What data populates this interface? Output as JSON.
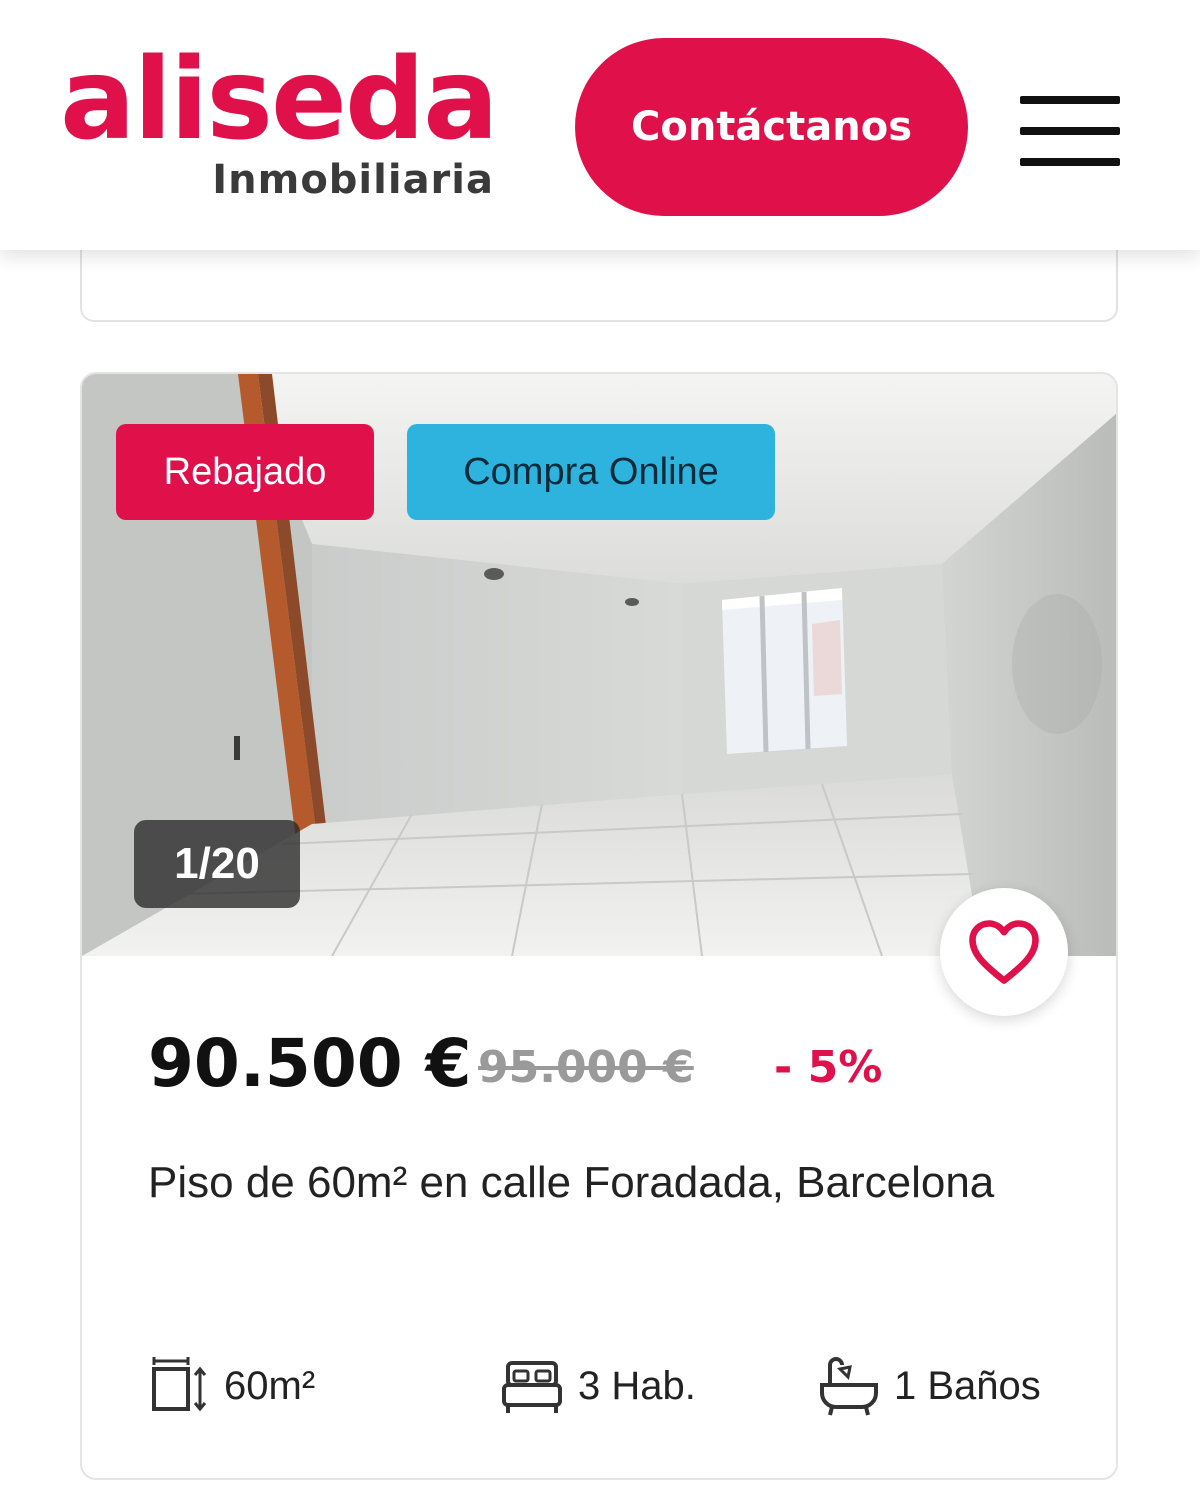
{
  "header": {
    "logo_word": "aliseda",
    "logo_sub": "Inmobiliaria",
    "contact_label": "Contáctanos"
  },
  "colors": {
    "brand": "#e0104a",
    "badge_online": "#2eb3df"
  },
  "listing": {
    "badges": {
      "discounted": "Rebajado",
      "online": "Compra Online"
    },
    "photo_counter": "1/20",
    "price": "90.500 €",
    "old_price": "95.000 €",
    "discount": "- 5%",
    "title": "Piso de 60m² en calle Foradada, Barcelona",
    "features": {
      "area": "60m²",
      "rooms": "3 Hab.",
      "baths": "1 Baños"
    },
    "icons": [
      "area-icon",
      "bed-icon",
      "bathtub-icon",
      "heart-icon"
    ]
  }
}
